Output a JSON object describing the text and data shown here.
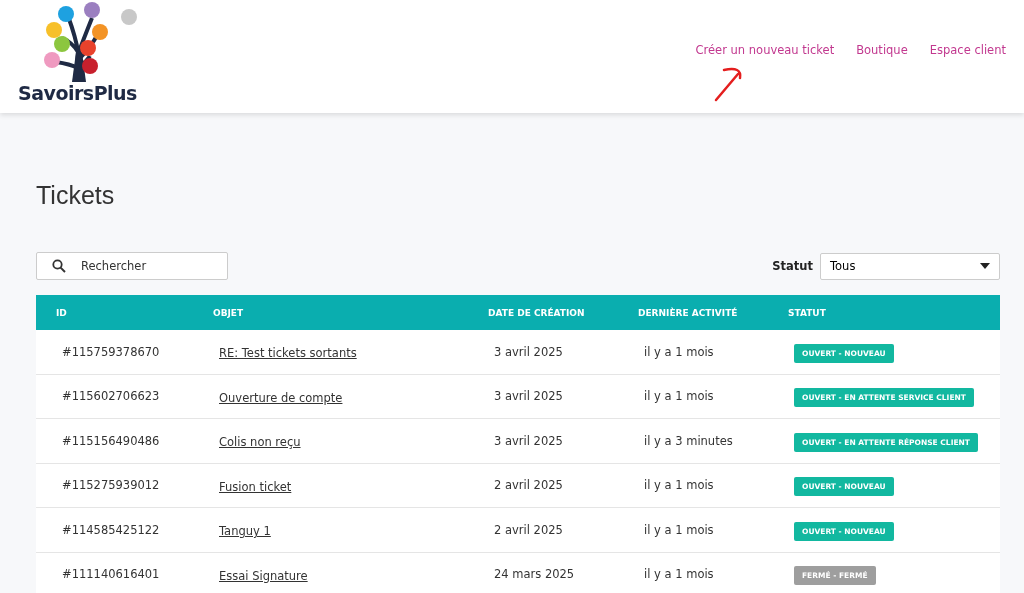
{
  "brand": {
    "name": "SavoirsPlus"
  },
  "nav": [
    {
      "label": "Créer un nouveau ticket"
    },
    {
      "label": "Boutique"
    },
    {
      "label": "Espace client"
    }
  ],
  "title": "Tickets",
  "search": {
    "placeholder": "Rechercher"
  },
  "filter": {
    "label": "Statut",
    "value": "Tous"
  },
  "table": {
    "columns": [
      "ID",
      "OBJET",
      "DATE DE CRÉATION",
      "DERNIÈRE ACTIVITÉ",
      "STATUT"
    ],
    "rows": [
      {
        "id": "#115759378670",
        "subject": "RE: Test tickets sortants",
        "created": "3 avril 2025",
        "activity": "il y a 1 mois",
        "status": "OUVERT - NOUVEAU",
        "color": "#12b8a0"
      },
      {
        "id": "#115602706623",
        "subject": "Ouverture de compte",
        "created": "3 avril 2025",
        "activity": "il y a 1 mois",
        "status": "OUVERT - EN ATTENTE SERVICE CLIENT",
        "color": "#12b8a0"
      },
      {
        "id": "#115156490486",
        "subject": "Colis non reçu",
        "created": "3 avril 2025",
        "activity": "il y a 3 minutes",
        "status": "OUVERT - EN ATTENTE RÉPONSE CLIENT",
        "color": "#12b8a0"
      },
      {
        "id": "#115275939012",
        "subject": "Fusion ticket",
        "created": "2 avril 2025",
        "activity": "il y a 1 mois",
        "status": "OUVERT - NOUVEAU",
        "color": "#12b8a0"
      },
      {
        "id": "#114585425122",
        "subject": "Tanguy 1",
        "created": "2 avril 2025",
        "activity": "il y a 1 mois",
        "status": "OUVERT - NOUVEAU",
        "color": "#12b8a0"
      },
      {
        "id": "#111140616401",
        "subject": "Essai Signature",
        "created": "24 mars 2025",
        "activity": "il y a 1 mois",
        "status": "FERMÉ - FERMÉ",
        "color": "#9e9e9e"
      }
    ]
  }
}
